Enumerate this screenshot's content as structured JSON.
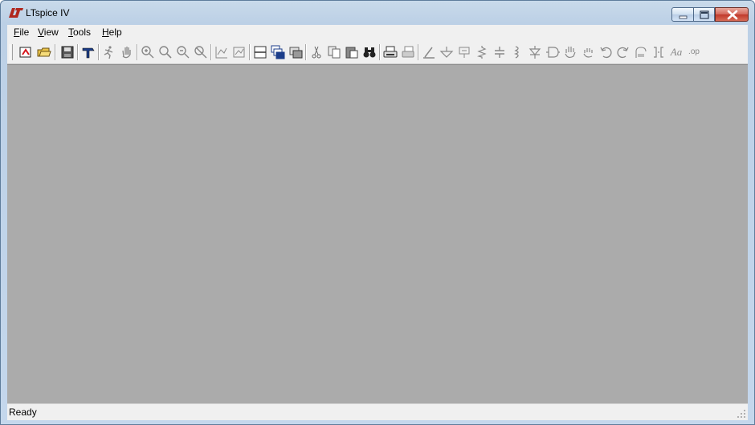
{
  "window": {
    "title": "LTspice IV",
    "controls": {
      "minimize": "minimize",
      "maximize": "maximize",
      "close": "close"
    }
  },
  "menu": {
    "items": [
      {
        "label": "File",
        "accel": "F",
        "rest": "ile"
      },
      {
        "label": "View",
        "accel": "V",
        "rest": "iew"
      },
      {
        "label": "Tools",
        "accel": "T",
        "rest": "ools"
      },
      {
        "label": "Help",
        "accel": "H",
        "rest": "elp"
      }
    ]
  },
  "toolbar": {
    "buttons": [
      "new-schematic-icon",
      "open-folder-icon",
      "save-icon",
      "control-panel-hammer-icon",
      "run-simulation-icon",
      "halt-hand-icon",
      "zoom-in-icon",
      "zoom-out-icon",
      "zoom-fit-icon",
      "zoom-cancel-icon",
      "autorange-y-icon",
      "autorange-x-icon",
      "tile-horizontal-icon",
      "cascade-windows-icon",
      "close-windows-icon",
      "cut-scissors-icon",
      "copy-icon",
      "paste-icon",
      "find-binoculars-icon",
      "print-icon",
      "print-preview-icon",
      "draw-wire-icon",
      "ground-icon",
      "label-net-icon",
      "resistor-icon",
      "capacitor-icon",
      "inductor-icon",
      "diode-icon",
      "component-icon",
      "move-hand-icon",
      "drag-hand-icon",
      "undo-icon",
      "redo-icon",
      "rotate-icon",
      "mirror-icon",
      "text-icon",
      "spice-directive-icon"
    ],
    "labels": {
      "text": "Aa",
      "spice": ".op"
    }
  },
  "status": {
    "text": "Ready"
  },
  "colors": {
    "workspace": "#ababab",
    "chrome": "#f0f0f0",
    "titlebar": "#c4d7ec",
    "accent": "#c0392b"
  }
}
